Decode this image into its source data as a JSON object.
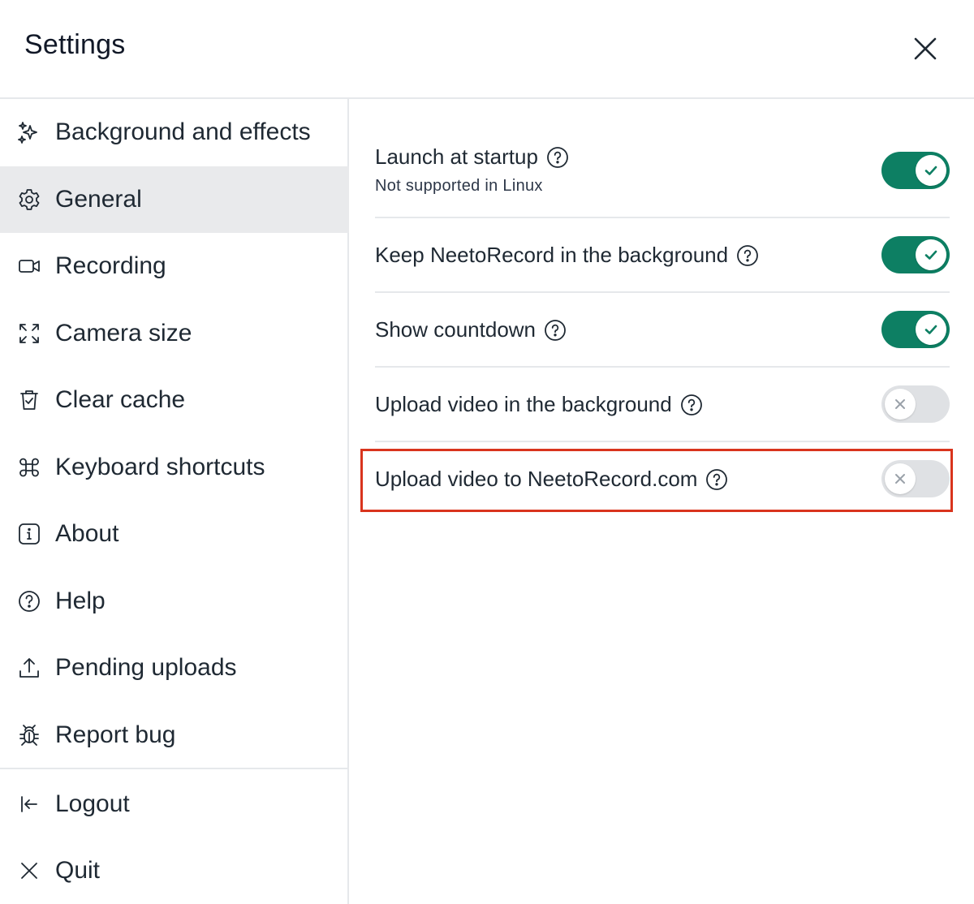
{
  "window": {
    "title": "Settings",
    "close_icon": "close-icon"
  },
  "sidebar": {
    "items": [
      {
        "id": "background-effects",
        "label": "Background and effects",
        "icon": "sparkles-icon",
        "active": false
      },
      {
        "id": "general",
        "label": "General",
        "icon": "gear-icon",
        "active": true
      },
      {
        "id": "recording",
        "label": "Recording",
        "icon": "video-camera-icon",
        "active": false
      },
      {
        "id": "camera-size",
        "label": "Camera size",
        "icon": "expand-icon",
        "active": false
      },
      {
        "id": "clear-cache",
        "label": "Clear cache",
        "icon": "trash-check-icon",
        "active": false
      },
      {
        "id": "keyboard-shortcuts",
        "label": "Keyboard shortcuts",
        "icon": "command-key-icon",
        "active": false
      },
      {
        "id": "about",
        "label": "About",
        "icon": "info-icon",
        "active": false
      },
      {
        "id": "help",
        "label": "Help",
        "icon": "question-circle-icon",
        "active": false
      },
      {
        "id": "pending-uploads",
        "label": "Pending uploads",
        "icon": "upload-icon",
        "active": false
      },
      {
        "id": "report-bug",
        "label": "Report bug",
        "icon": "bug-icon",
        "active": false
      }
    ],
    "footer_items": [
      {
        "id": "logout",
        "label": "Logout",
        "icon": "logout-arrow-icon"
      },
      {
        "id": "quit",
        "label": "Quit",
        "icon": "x-icon"
      }
    ]
  },
  "general": {
    "settings": [
      {
        "id": "launch-at-startup",
        "label": "Launch at startup",
        "sublabel": "Not supported in Linux",
        "enabled": true
      },
      {
        "id": "keep-in-background",
        "label": "Keep NeetoRecord in the background",
        "enabled": true
      },
      {
        "id": "show-countdown",
        "label": "Show countdown",
        "enabled": true
      },
      {
        "id": "upload-in-background",
        "label": "Upload video in the background",
        "enabled": false
      },
      {
        "id": "upload-to-neetorecord",
        "label": "Upload video to NeetoRecord.com",
        "enabled": false,
        "highlighted": true
      }
    ]
  },
  "colors": {
    "toggle_on": "#0d7f63",
    "toggle_off": "#dfe1e4",
    "highlight": "#d9341d",
    "active_nav_bg": "#e9eaec"
  }
}
